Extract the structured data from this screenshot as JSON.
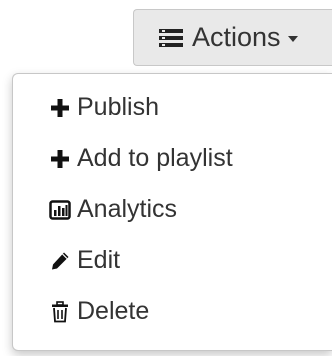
{
  "actions_button": {
    "label": "Actions",
    "icon": "list-icon"
  },
  "menu": {
    "items": [
      {
        "label": "Publish",
        "icon": "plus-icon"
      },
      {
        "label": "Add to playlist",
        "icon": "plus-icon"
      },
      {
        "label": "Analytics",
        "icon": "bar-chart-icon"
      },
      {
        "label": "Edit",
        "icon": "pencil-icon"
      },
      {
        "label": "Delete",
        "icon": "trash-icon"
      }
    ]
  }
}
